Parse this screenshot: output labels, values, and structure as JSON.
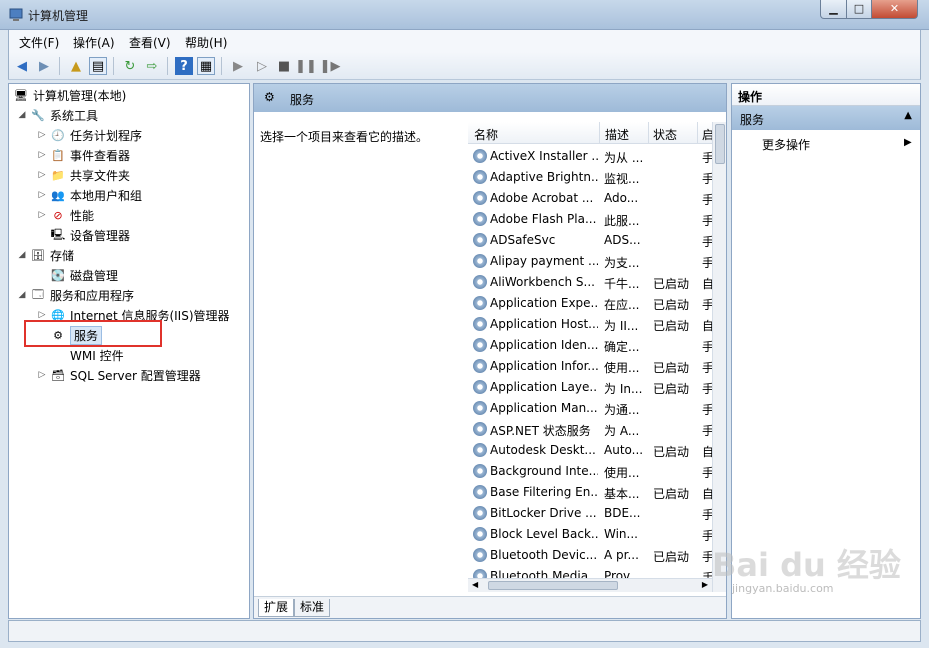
{
  "window": {
    "title": "计算机管理"
  },
  "menu": [
    "文件(F)",
    "操作(A)",
    "查看(V)",
    "帮助(H)"
  ],
  "tree": {
    "root": "计算机管理(本地)",
    "system_tools": "系统工具",
    "task_scheduler": "任务计划程序",
    "event_viewer": "事件查看器",
    "shared_folders": "共享文件夹",
    "local_users": "本地用户和组",
    "performance": "性能",
    "device_manager": "设备管理器",
    "storage": "存储",
    "disk_management": "磁盘管理",
    "services_apps": "服务和应用程序",
    "iis": "Internet 信息服务(IIS)管理器",
    "services": "服务",
    "wmi": "WMI 控件",
    "sql": "SQL Server 配置管理器"
  },
  "middle": {
    "title": "服务",
    "description": "选择一个项目来查看它的描述。",
    "columns": {
      "name": "名称",
      "desc": "描述",
      "status": "状态",
      "startup": "启"
    },
    "rows": [
      {
        "name": "ActiveX Installer ...",
        "desc": "为从 ...",
        "status": "",
        "startup": "手"
      },
      {
        "name": "Adaptive Brightn...",
        "desc": "监视...",
        "status": "",
        "startup": "手"
      },
      {
        "name": "Adobe Acrobat ...",
        "desc": "Ado...",
        "status": "",
        "startup": "手"
      },
      {
        "name": "Adobe Flash Pla...",
        "desc": "此服...",
        "status": "",
        "startup": "手"
      },
      {
        "name": "ADSafeSvc",
        "desc": "ADS...",
        "status": "",
        "startup": "手"
      },
      {
        "name": "Alipay payment ...",
        "desc": "为支...",
        "status": "",
        "startup": "手"
      },
      {
        "name": "AliWorkbench S...",
        "desc": "千牛...",
        "status": "已启动",
        "startup": "自"
      },
      {
        "name": "Application Expe...",
        "desc": "在应...",
        "status": "已启动",
        "startup": "手"
      },
      {
        "name": "Application Host...",
        "desc": "为 II...",
        "status": "已启动",
        "startup": "自"
      },
      {
        "name": "Application Iden...",
        "desc": "确定...",
        "status": "",
        "startup": "手"
      },
      {
        "name": "Application Infor...",
        "desc": "使用...",
        "status": "已启动",
        "startup": "手"
      },
      {
        "name": "Application Laye...",
        "desc": "为 In...",
        "status": "已启动",
        "startup": "手"
      },
      {
        "name": "Application Man...",
        "desc": "为通...",
        "status": "",
        "startup": "手"
      },
      {
        "name": "ASP.NET 状态服务",
        "desc": "为 A...",
        "status": "",
        "startup": "手"
      },
      {
        "name": "Autodesk Deskt...",
        "desc": "Auto...",
        "status": "已启动",
        "startup": "自"
      },
      {
        "name": "Background Inte...",
        "desc": "使用...",
        "status": "",
        "startup": "手"
      },
      {
        "name": "Base Filtering En...",
        "desc": "基本...",
        "status": "已启动",
        "startup": "自"
      },
      {
        "name": "BitLocker Drive ...",
        "desc": "BDE...",
        "status": "",
        "startup": "手"
      },
      {
        "name": "Block Level Back...",
        "desc": "Win...",
        "status": "",
        "startup": "手"
      },
      {
        "name": "Bluetooth Devic...",
        "desc": "A pr...",
        "status": "已启动",
        "startup": "手"
      },
      {
        "name": "Bluetooth Media...",
        "desc": "Prov...",
        "status": "",
        "startup": "手"
      }
    ],
    "tabs": [
      "扩展",
      "标准"
    ]
  },
  "actions": {
    "title": "操作",
    "section": "服务",
    "more": "更多操作"
  },
  "watermark": {
    "brand": "Bai du 经验",
    "url": "jingyan.baidu.com"
  }
}
